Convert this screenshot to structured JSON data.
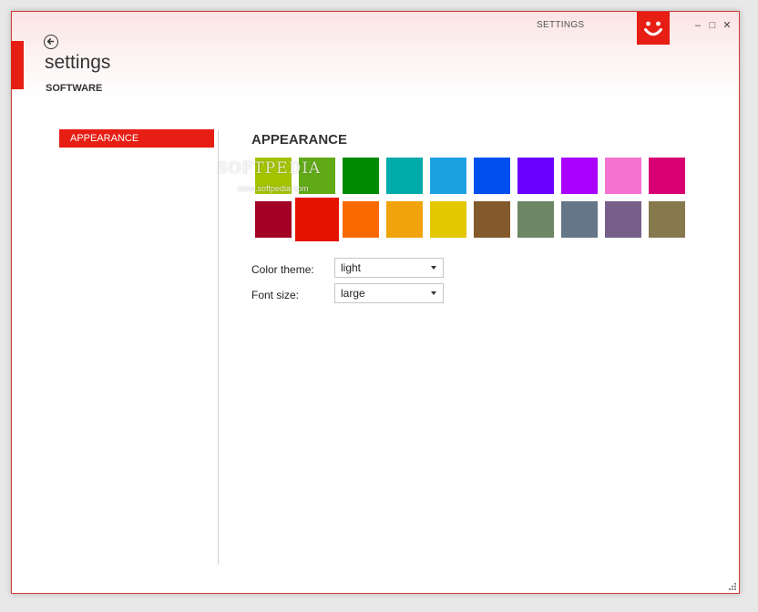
{
  "window": {
    "title": "SETTINGS",
    "controls": {
      "minimize": "–",
      "maximize": "□",
      "close": "✕"
    }
  },
  "header": {
    "title": "settings",
    "subtitle": "SOFTWARE"
  },
  "sidebar": {
    "items": [
      {
        "label": "APPEARANCE",
        "active": true
      }
    ]
  },
  "main": {
    "heading": "APPEARANCE",
    "watermark": "SOFTPEDIA",
    "watermark_url": "www.softpedia.com",
    "swatches": [
      [
        "#a4c400",
        "#60a917",
        "#008a00",
        "#00aba9",
        "#1ba1e2",
        "#0050ef",
        "#6a00ff",
        "#aa00ff",
        "#f472d0",
        "#d80073"
      ],
      [
        "#a20025",
        "#e51400",
        "#fa6800",
        "#f0a30a",
        "#e3c800",
        "#825a2c",
        "#6d8764",
        "#647687",
        "#76608a",
        "#87794e"
      ]
    ],
    "selected_swatch": "#e51400",
    "color_theme": {
      "label": "Color theme:",
      "value": "light"
    },
    "font_size": {
      "label": "Font size:",
      "value": "large"
    }
  },
  "colors": {
    "accent": "#e61e14"
  },
  "icons": {
    "back": "back-arrow-icon",
    "logo": "smiley-logo"
  }
}
